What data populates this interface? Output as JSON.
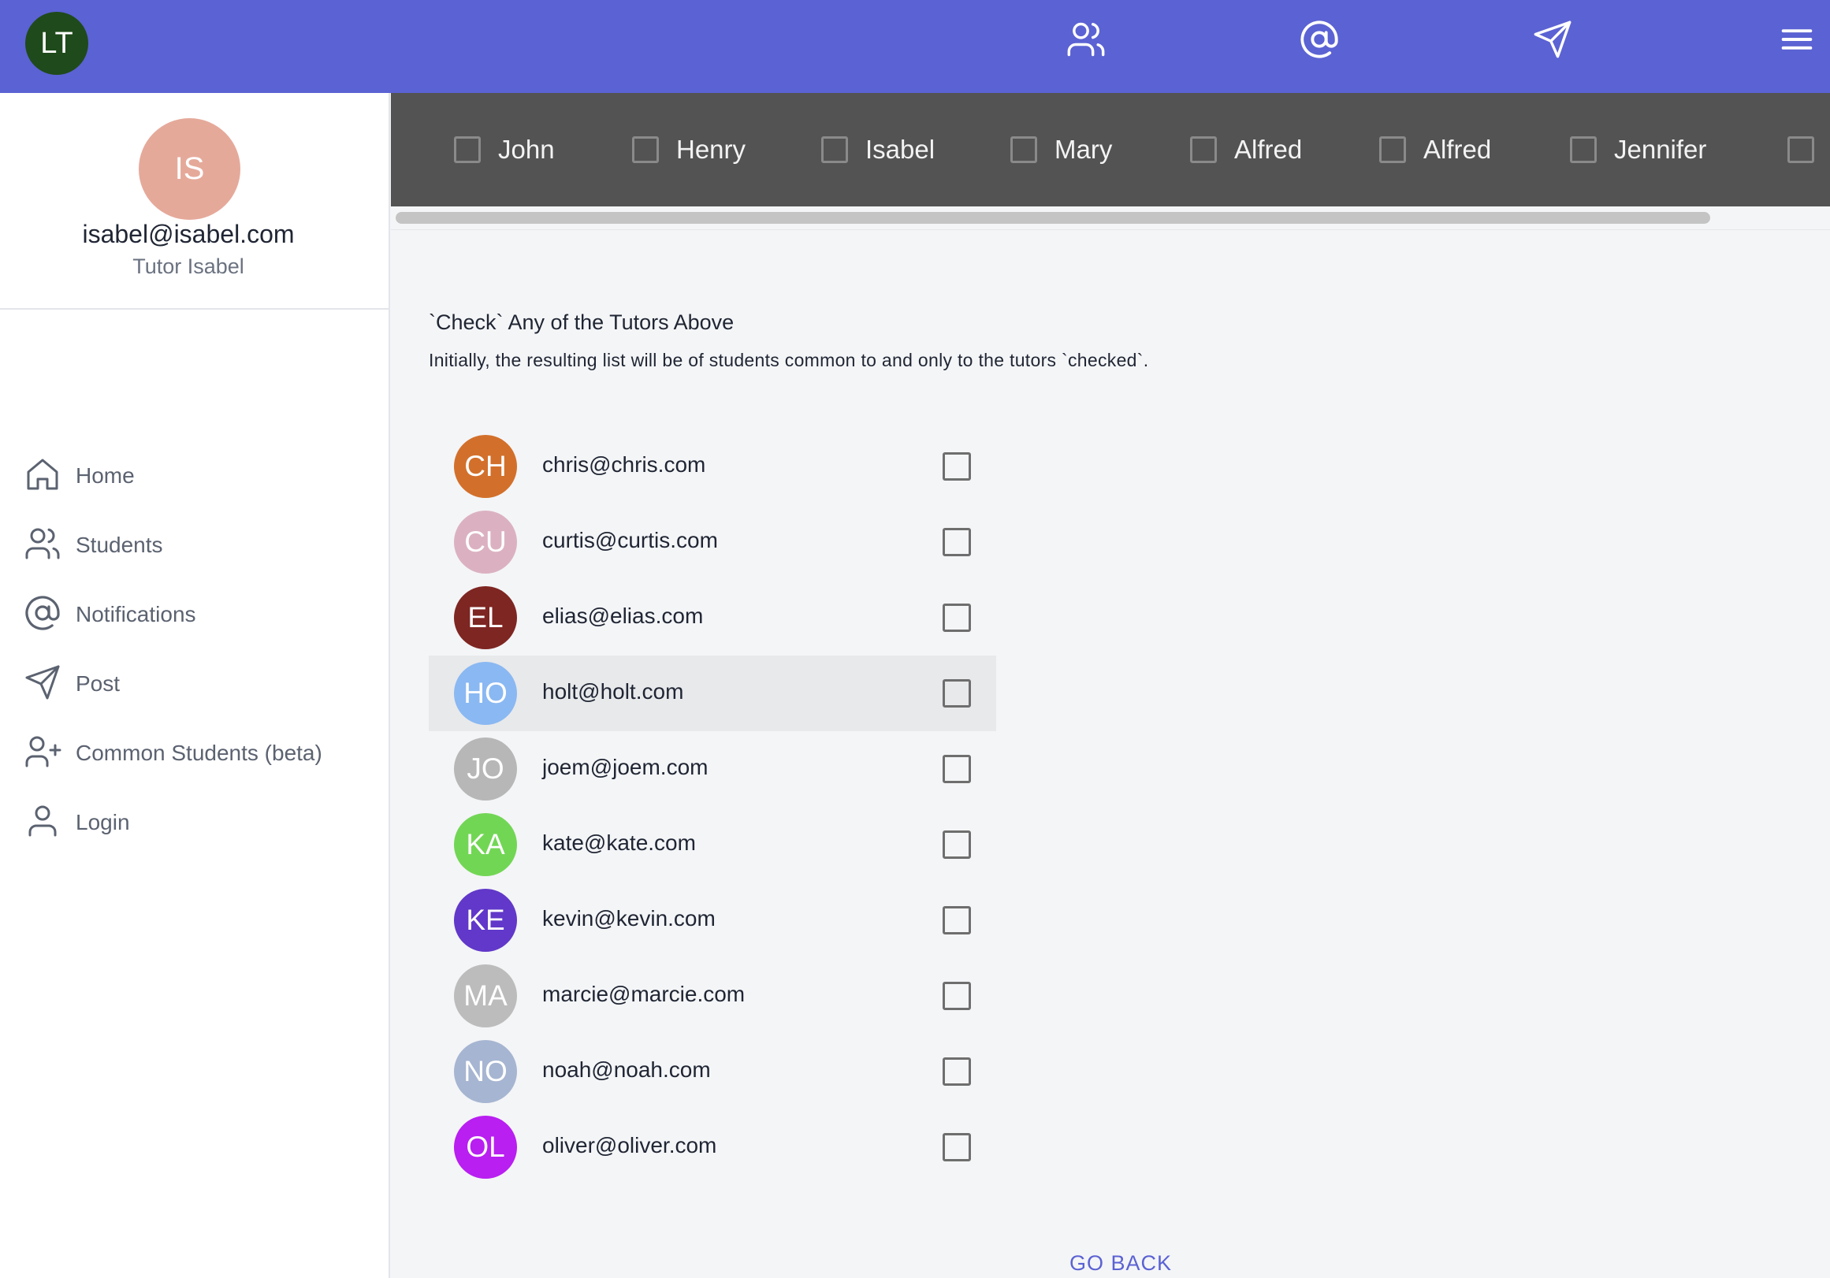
{
  "app": {
    "avatar_initials": "LT",
    "accent_color": "#5b62d3"
  },
  "topbar": {
    "icons": [
      "users-icon",
      "at-sign-icon",
      "send-icon",
      "menu-icon"
    ]
  },
  "profile": {
    "initials": "IS",
    "email": "isabel@isabel.com",
    "role": "Tutor Isabel"
  },
  "sidebar": {
    "items": [
      {
        "label": "Home",
        "icon": "home-icon"
      },
      {
        "label": "Students",
        "icon": "users-icon"
      },
      {
        "label": "Notifications",
        "icon": "at-sign-icon"
      },
      {
        "label": "Post",
        "icon": "send-icon"
      },
      {
        "label": "Common Students (beta)",
        "icon": "user-plus-icon"
      },
      {
        "label": "Login",
        "icon": "user-icon"
      }
    ]
  },
  "tutors": [
    "John",
    "Henry",
    "Isabel",
    "Mary",
    "Alfred",
    "Alfred",
    "Jennifer"
  ],
  "main": {
    "title": "`Check` Any of the Tutors Above",
    "description": "Initially, the resulting list will be of students common to and only to the tutors `checked`.",
    "go_back": "GO BACK"
  },
  "students": [
    {
      "initials": "CH",
      "email": "chris@chris.com",
      "color": "#d2702b"
    },
    {
      "initials": "CU",
      "email": "curtis@curtis.com",
      "color": "#dbb1c1"
    },
    {
      "initials": "EL",
      "email": "elias@elias.com",
      "color": "#7e2622"
    },
    {
      "initials": "HO",
      "email": "holt@holt.com",
      "color": "#8ab8f2"
    },
    {
      "initials": "JO",
      "email": "joem@joem.com",
      "color": "#b7b7b7"
    },
    {
      "initials": "KA",
      "email": "kate@kate.com",
      "color": "#72d655"
    },
    {
      "initials": "KE",
      "email": "kevin@kevin.com",
      "color": "#6138c9"
    },
    {
      "initials": "MA",
      "email": "marcie@marcie.com",
      "color": "#bcbcbc"
    },
    {
      "initials": "NO",
      "email": "noah@noah.com",
      "color": "#a6b5d1"
    },
    {
      "initials": "OL",
      "email": "oliver@oliver.com",
      "color": "#b81ff0"
    }
  ]
}
